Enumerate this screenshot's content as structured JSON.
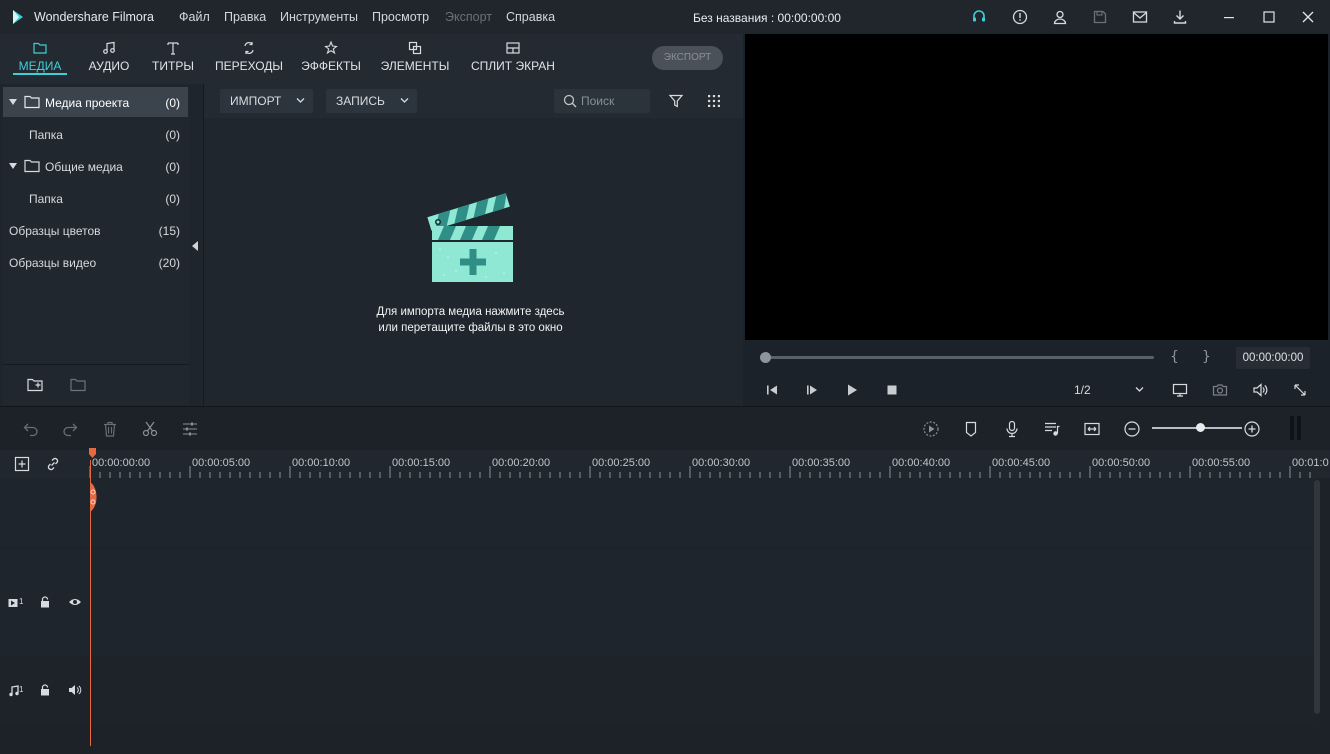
{
  "app": {
    "name": "Wondershare Filmora",
    "document_title": "Без названия : 00:00:00:00"
  },
  "menu": {
    "items": [
      {
        "label": "Файл",
        "disabled": false
      },
      {
        "label": "Правка",
        "disabled": false
      },
      {
        "label": "Инструменты",
        "disabled": false
      },
      {
        "label": "Просмотр",
        "disabled": false
      },
      {
        "label": "Экспорт",
        "disabled": true
      },
      {
        "label": "Справка",
        "disabled": false
      }
    ]
  },
  "title_icons": [
    "headset-icon",
    "info-icon",
    "account-icon",
    "save-icon",
    "mail-icon",
    "download-icon",
    "minimize-icon",
    "maximize-icon",
    "close-icon"
  ],
  "tabs": [
    {
      "label": "МЕДИА",
      "icon": "folder-icon",
      "active": true
    },
    {
      "label": "АУДИО",
      "icon": "music-note-icon",
      "active": false
    },
    {
      "label": "ТИТРЫ",
      "icon": "text-icon",
      "active": false
    },
    {
      "label": "ПЕРЕХОДЫ",
      "icon": "transition-icon",
      "active": false
    },
    {
      "label": "ЭФФЕКТЫ",
      "icon": "effects-icon",
      "active": false
    },
    {
      "label": "ЭЛЕМЕНТЫ",
      "icon": "elements-icon",
      "active": false
    },
    {
      "label": "СПЛИТ ЭКРАН",
      "icon": "split-screen-icon",
      "active": false
    }
  ],
  "export_button": "ЭКСПОРТ",
  "sidebar": {
    "items": [
      {
        "label": "Медиа проекта",
        "count": "(0)",
        "expandable": true,
        "active": true
      },
      {
        "label": "Папка",
        "count": "(0)",
        "expandable": false,
        "active": false
      },
      {
        "label": "Общие медиа",
        "count": "(0)",
        "expandable": true,
        "active": false
      },
      {
        "label": "Папка",
        "count": "(0)",
        "expandable": false,
        "active": false
      },
      {
        "label": "Образцы цветов",
        "count": "(15)",
        "expandable": false,
        "active": false
      },
      {
        "label": "Образцы видео",
        "count": "(20)",
        "expandable": false,
        "active": false
      }
    ]
  },
  "media": {
    "import_label": "ИМПОРТ",
    "record_label": "ЗАПИСЬ",
    "search_placeholder": "Поиск",
    "hint_line1": "Для импорта медиа нажмите здесь",
    "hint_line2": "или перетащите файлы в это окно"
  },
  "preview": {
    "in_brace": "{",
    "out_brace": "}",
    "timecode": "00:00:00:00",
    "ratio": "1/2"
  },
  "timeline": {
    "ruler_labels": [
      "00:00:00:00",
      "00:00:05:00",
      "00:00:10:00",
      "00:00:15:00",
      "00:00:20:00",
      "00:00:25:00",
      "00:00:30:00",
      "00:00:35:00",
      "00:00:40:00",
      "00:00:45:00",
      "00:00:50:00",
      "00:00:55:00",
      "00:01:0"
    ],
    "video_track_label": "1",
    "audio_track_label": "1"
  },
  "colors": {
    "accent": "#3ed0d6",
    "playhead": "#e8693f",
    "clapper": "#8fe8d4",
    "clapper_stripe": "#2f8f86"
  }
}
